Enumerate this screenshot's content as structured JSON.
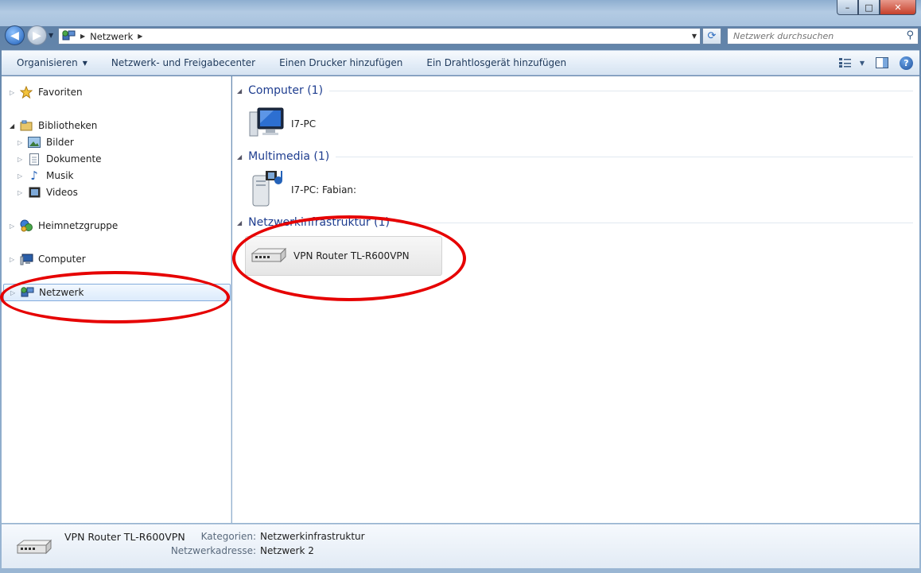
{
  "window": {
    "minimize": "–",
    "maximize": "□",
    "close": "✕"
  },
  "address": {
    "path": "Netzwerk",
    "search_placeholder": "Netzwerk durchsuchen"
  },
  "toolbar": {
    "organize": "Organisieren",
    "network_center": "Netzwerk- und Freigabecenter",
    "add_printer": "Einen Drucker hinzufügen",
    "add_wireless": "Ein Drahtlosgerät hinzufügen"
  },
  "sidebar": {
    "items": [
      {
        "label": "Favoriten"
      },
      {
        "label": "Bibliotheken"
      },
      {
        "label": "Bilder"
      },
      {
        "label": "Dokumente"
      },
      {
        "label": "Musik"
      },
      {
        "label": "Videos"
      },
      {
        "label": "Heimnetzgruppe"
      },
      {
        "label": "Computer"
      },
      {
        "label": "Netzwerk"
      }
    ]
  },
  "groups": [
    {
      "label": "Computer (1)",
      "items": [
        {
          "label": "I7-PC"
        }
      ]
    },
    {
      "label": "Multimedia (1)",
      "items": [
        {
          "label": "I7-PC: Fabian:"
        }
      ]
    },
    {
      "label": "Netzwerkinfrastruktur (1)",
      "items": [
        {
          "label": "VPN Router TL-R600VPN"
        }
      ]
    }
  ],
  "details": {
    "name": "VPN Router TL-R600VPN",
    "category_key": "Kategorien:",
    "category_value": "Netzwerkinfrastruktur",
    "address_key": "Netzwerkadresse:",
    "address_value": "Netzwerk 2"
  },
  "colors": {
    "highlight_ring": "#e60000",
    "group_header": "#1e3d8f"
  }
}
